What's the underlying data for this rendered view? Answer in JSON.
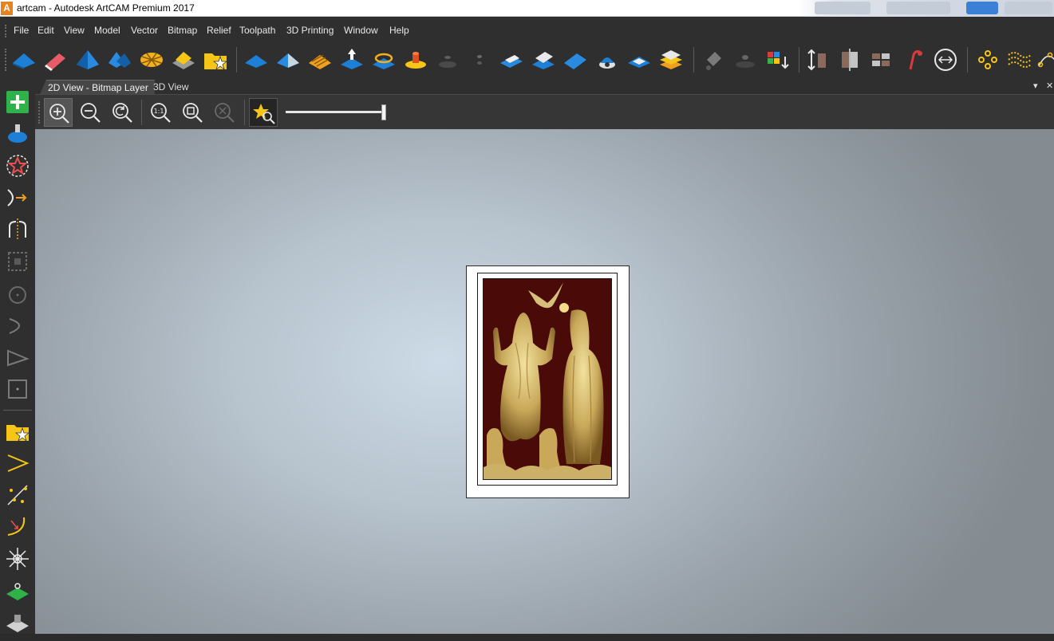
{
  "window": {
    "app_logo": "A",
    "title": "artcam - Autodesk ArtCAM Premium 2017"
  },
  "menu": [
    {
      "label": "File"
    },
    {
      "label": "Edit"
    },
    {
      "label": "View"
    },
    {
      "label": "Model"
    },
    {
      "label": "Vector"
    },
    {
      "label": "Bitmap"
    },
    {
      "label": "Relief"
    },
    {
      "label": "Toolpath"
    },
    {
      "label": "3D Printing"
    },
    {
      "label": "Window"
    },
    {
      "label": "Help"
    }
  ],
  "toolbar_icons": [
    "blue-plane-icon",
    "eraser-icon",
    "blue-peak-icon",
    "blue-split-peak-icon",
    "weave-icon",
    "yellow-stack-icon",
    "folder-star-icon",
    "blue-plane-icon",
    "blue-angle-icon",
    "layers-gold-icon",
    "blue-arrow-up-icon",
    "blue-ring-icon",
    "orange-button-icon",
    "small-disk-icon",
    "pin-icon",
    "relief-block-icon",
    "relief-wave-icon",
    "blue-sheet-icon",
    "dome-star-icon",
    "blue-diamond-icon",
    "stack-layers-icon",
    "fill-bucket-icon",
    "dark-disk-icon",
    "color-grid-icon",
    "measure-height-icon",
    "mirror-icon",
    "tile-icon",
    "lamp-icon",
    "circle-arrows-icon",
    "node-points-icon",
    "wave-dots-icon",
    "curve-nodes-icon"
  ],
  "tabs": {
    "active": "2D View - Bitmap Layer",
    "inactive": "3D View",
    "dropdown": "▾",
    "close": "✕"
  },
  "view_toolbar": {
    "zoom_label": "1:1",
    "icons": [
      "zoom-in-icon",
      "zoom-out-icon",
      "zoom-previous-icon",
      "zoom-1to1-icon",
      "zoom-fit-icon",
      "zoom-selection-icon",
      "favorite-search-icon"
    ],
    "slider_value": 1.0
  },
  "left_tools": [
    "add-green-icon",
    "blue-bottle-icon",
    "star-hatch-icon",
    "curve-arrow-icon",
    "mirror-shape-icon",
    "dotted-square-icon",
    "circle-dot-icon",
    "arc-icon",
    "triangle-icon",
    "square-point-icon",
    "folder-star-icon",
    "chevron-vector-icon",
    "scatter-icon",
    "curve-down-icon",
    "star-burst-icon",
    "green-plane-icon",
    "machine-icon"
  ],
  "colors": {
    "relief_background": "#4a0a08",
    "relief_gold": "#d8c27a",
    "accent_blue": "#1e88e5"
  }
}
